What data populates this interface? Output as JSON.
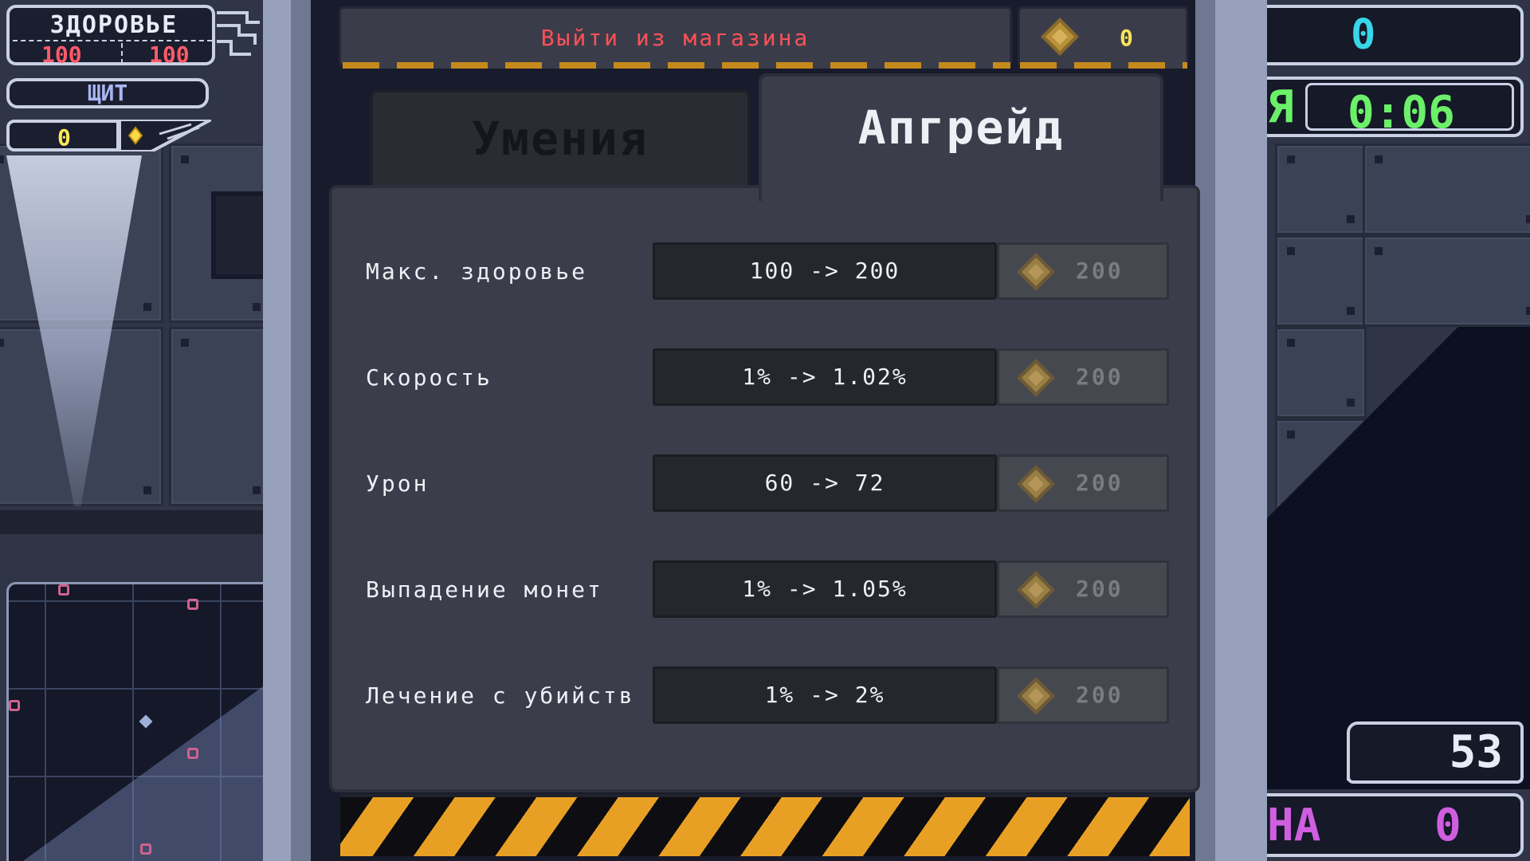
{
  "hud": {
    "health_title": "ЗДОРОВЬЕ",
    "health_current": "100",
    "health_max": "100",
    "shield_label": "ЩИТ",
    "coins": "0",
    "right_top_value": "0",
    "timer_label_fragment": "Я",
    "timer_value": "0:06",
    "right_counter": "53",
    "wave_label_fragment": "НА",
    "wave_value": "0"
  },
  "shop": {
    "exit_label": "Выйти из магазина",
    "coin_balance": "0",
    "tabs": [
      {
        "label": "Умения",
        "active": false
      },
      {
        "label": "Апгрейд",
        "active": true
      }
    ],
    "upgrades": [
      {
        "name": "Макс. здоровье",
        "change": "100 -> 200",
        "price": "200"
      },
      {
        "name": "Скорость",
        "change": "1% -> 1.02%",
        "price": "200"
      },
      {
        "name": "Урон",
        "change": "60 -> 72",
        "price": "200"
      },
      {
        "name": "Выпадение монет",
        "change": "1% -> 1.05%",
        "price": "200"
      },
      {
        "name": "Лечение с убийств",
        "change": "1% -> 2%",
        "price": "200"
      }
    ]
  },
  "colors": {
    "exit_text": "#ff5058",
    "coin_text": "#ffe45a",
    "health_text": "#ff5a6a",
    "timer_text": "#6cf06a",
    "cyan_text": "#38d6e8",
    "wave_text": "#d05ee0",
    "hazard_yellow": "#e8a024"
  }
}
